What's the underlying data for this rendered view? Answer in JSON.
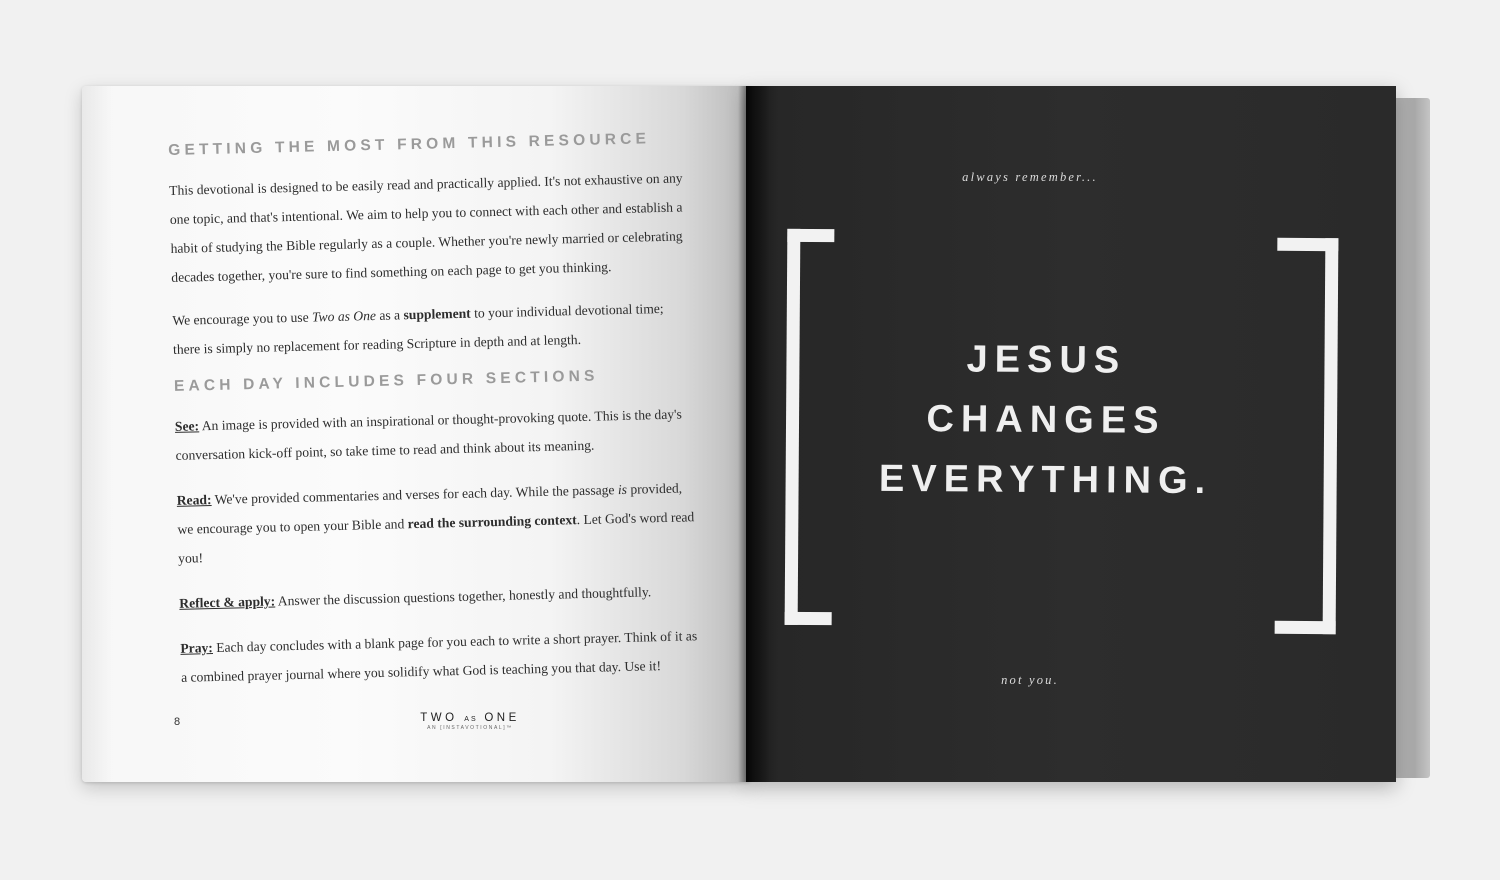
{
  "left_page": {
    "heading1": "GETTING THE MOST FROM THIS RESOURCE",
    "p1": "This devotional is designed to be easily read and practically applied. It's not exhaustive on any one topic, and that's intentional. We aim to help you to connect with each other and establish a habit of studying the Bible regularly as a couple. Whether you're newly married or celebrating decades together, you're sure to find something on each page to get you thinking.",
    "p2": {
      "a": "We encourage you to use ",
      "title": "Two as One",
      "b": " as a ",
      "strong": "supplement",
      "c": " to your individual devotional time; there is simply no replacement for reading Scripture in depth and at length."
    },
    "heading2": "EACH DAY INCLUDES FOUR SECTIONS",
    "sections": {
      "see": {
        "label": "See:",
        "text": "  An image is provided with an inspirational or thought-provoking quote. This is the day's conversation kick-off point, so take time to read and think about its meaning."
      },
      "read": {
        "label": "Read:",
        "text_a": " We've provided commentaries and verses for each day.  While the passage ",
        "em": "is",
        "text_b": " provided, we encourage you to open your Bible and ",
        "strong": "read the surrounding context",
        "text_c": ". Let God's word read you!"
      },
      "reflect": {
        "label": "Reflect & apply:",
        "text": " Answer the discussion questions together, honestly and thoughtfully."
      },
      "pray": {
        "label": "Pray:",
        "text": " Each day concludes with a blank page for you each to write a short prayer. Think of it as a combined prayer journal where you solidify what God is teaching you that day. Use it!"
      }
    },
    "footer": {
      "page_number": "8",
      "brand_a": "TWO",
      "brand_as": "AS",
      "brand_b": "ONE",
      "brand_sub": "AN [INSTAVOTIONAL]™"
    }
  },
  "right_page": {
    "top_text": "always remember...",
    "headline": [
      "JESUS",
      "CHANGES",
      "EVERYTHING."
    ],
    "bottom_text": "not you."
  }
}
